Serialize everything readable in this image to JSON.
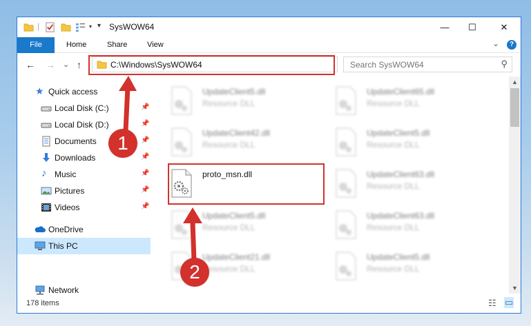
{
  "window": {
    "title": "SysWOW64",
    "controls": {
      "minimize": "—",
      "maximize": "☐",
      "close": "✕"
    }
  },
  "ribbon": {
    "tabs": [
      "File",
      "Home",
      "Share",
      "View"
    ],
    "collapse_glyph": "⌄",
    "help_glyph": "?"
  },
  "navbar": {
    "back": "←",
    "forward": "→",
    "recent": "⌄",
    "up": "↑",
    "address": "C:\\Windows\\SysWOW64",
    "address_dropdown": "⌄",
    "refresh": "↻",
    "search_placeholder": "Search SysWOW64",
    "search_glyph": "⚲"
  },
  "sidebar": {
    "pin_glyph": "📌",
    "items": [
      {
        "label": "Quick access",
        "icon": "star-icon"
      },
      {
        "label": "Local Disk (C:)",
        "icon": "drive-icon",
        "pinned": true
      },
      {
        "label": "Local Disk (D:)",
        "icon": "drive-icon",
        "pinned": true
      },
      {
        "label": "Documents",
        "icon": "documents-icon",
        "pinned": true
      },
      {
        "label": "Downloads",
        "icon": "downloads-icon",
        "pinned": true
      },
      {
        "label": "Music",
        "icon": "music-icon",
        "pinned": true
      },
      {
        "label": "Pictures",
        "icon": "pictures-icon",
        "pinned": true
      },
      {
        "label": "Videos",
        "icon": "videos-icon",
        "pinned": true
      },
      {
        "label": "OneDrive",
        "icon": "onedrive-icon"
      },
      {
        "label": "This PC",
        "icon": "computer-icon",
        "selected": true
      },
      {
        "label": "Network",
        "icon": "network-icon"
      }
    ]
  },
  "files": [
    {
      "name": "UpdateClient5.dll",
      "type": "Resource DLL"
    },
    {
      "name": "UpdateClient65.dll",
      "type": "Resource DLL"
    },
    {
      "name": "UpdateClient42.dll",
      "type": "Resource DLL"
    },
    {
      "name": "UpdateClient5.dll",
      "type": "Resource DLL"
    },
    {
      "name": "proto_msn.dll",
      "type": "",
      "highlighted": true
    },
    {
      "name": "UpdateClient63.dll",
      "type": "Resource DLL"
    },
    {
      "name": "UpdateClient5.dll",
      "type": "Resource DLL"
    },
    {
      "name": "UpdateClient63.dll",
      "type": "Resource DLL"
    },
    {
      "name": "UpdateClient21.dll",
      "type": "Resource DLL"
    },
    {
      "name": "UpdateClient5.dll",
      "type": "Resource DLL"
    }
  ],
  "statusbar": {
    "item_count": "178 items",
    "view_details": "☷",
    "view_tiles": "▭"
  },
  "annotations": [
    {
      "label": "1",
      "target": "address bar"
    },
    {
      "label": "2",
      "target": "proto_msn.dll"
    }
  ],
  "colors": {
    "accent": "#1979ca",
    "annotation_red": "#d2312c",
    "selection": "#cce8ff"
  }
}
